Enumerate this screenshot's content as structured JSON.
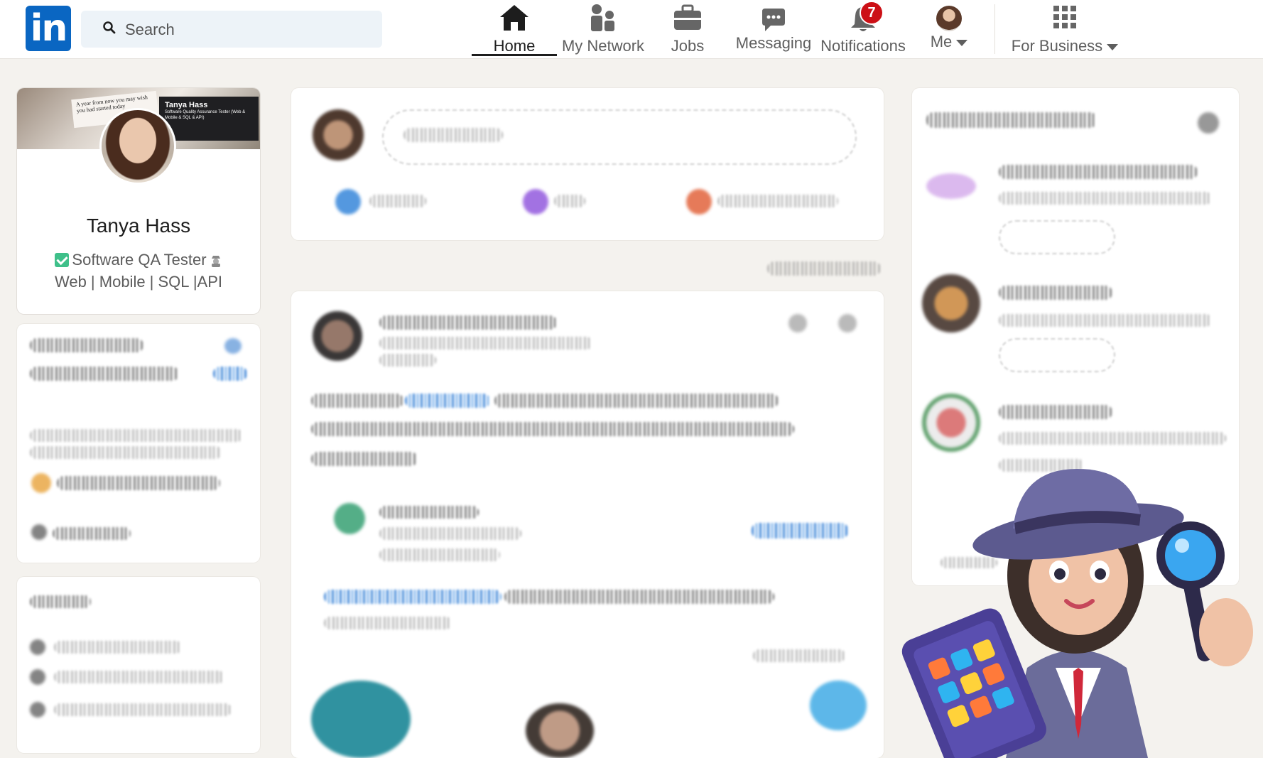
{
  "nav": {
    "logo": "in",
    "search_placeholder": "Search",
    "items": [
      {
        "label": "Home",
        "icon": "home-icon"
      },
      {
        "label": "My Network",
        "icon": "network-icon"
      },
      {
        "label": "Jobs",
        "icon": "briefcase-icon"
      },
      {
        "label": "Messaging",
        "icon": "chat-icon"
      },
      {
        "label": "Notifications",
        "icon": "bell-icon"
      },
      {
        "label": "Me",
        "icon": "avatar"
      },
      {
        "label": "For Business",
        "icon": "grid-icon"
      }
    ],
    "notifications_count": "7",
    "active_item": "Home"
  },
  "profile": {
    "name": "Tanya Hass",
    "headline_line1": "Software QA Tester",
    "headline_line2": "Web | Mobile | SQL |API",
    "banner": {
      "note_text": "A year from now you may wish you had started today",
      "card_name": "Tanya Hass",
      "card_line": "Software Quality Assurance Tester (Web & Mobile & SQL & API)"
    }
  },
  "colors": {
    "brand": "#0a66c2",
    "badge": "#cc1016",
    "page_bg": "#f4f2ee"
  }
}
